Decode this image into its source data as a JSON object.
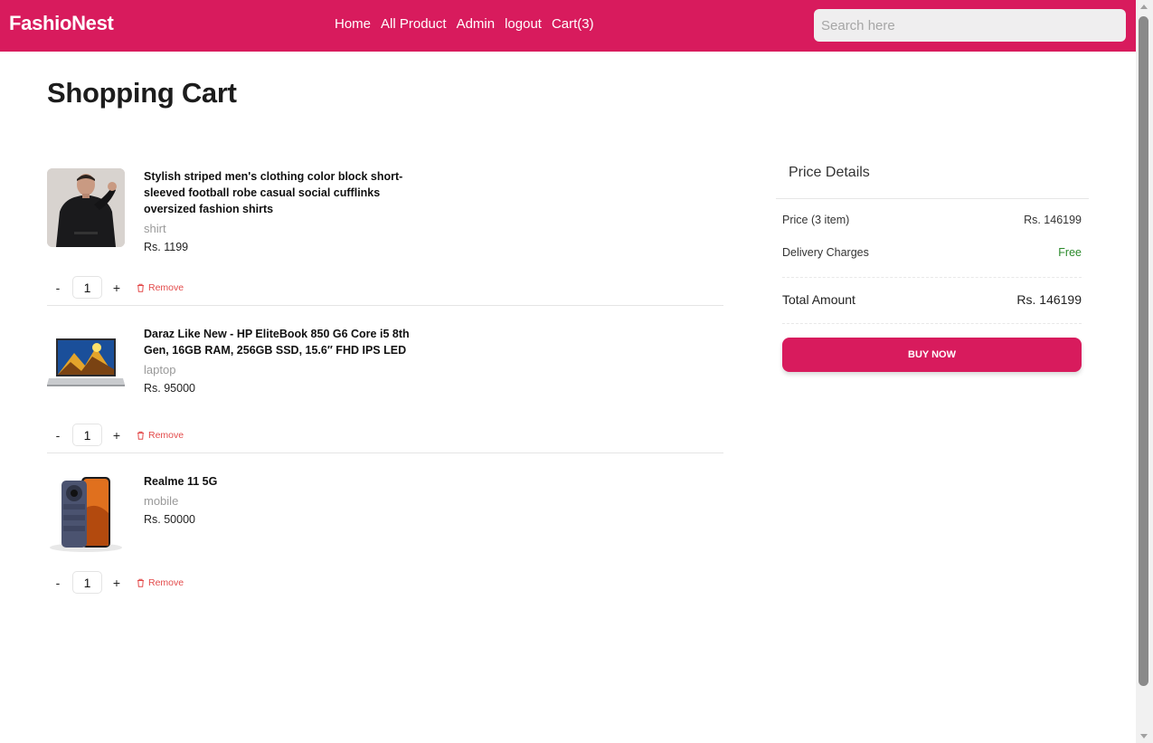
{
  "header": {
    "brand": "FashioNest",
    "nav": [
      "Home",
      "All Product",
      "Admin",
      "logout",
      "Cart(3)"
    ],
    "search_placeholder": "Search here",
    "brand_color": "#d81b5d"
  },
  "page_title": "Shopping Cart",
  "cart": {
    "items": [
      {
        "name": "Stylish striped men's clothing color block short-sleeved football robe casual social cufflinks oversized fashion shirts",
        "category": "shirt",
        "price": "Rs. 1199",
        "quantity": "1",
        "image_icon": "black-shirt-photo"
      },
      {
        "name": "Daraz Like New - HP EliteBook 850 G6 Core i5 8th Gen, 16GB RAM, 256GB SSD, 15.6″ FHD IPS LED",
        "category": "laptop",
        "price": "Rs. 95000",
        "quantity": "1",
        "image_icon": "laptop-photo"
      },
      {
        "name": "Realme 11 5G",
        "category": "mobile",
        "price": "Rs. 50000",
        "quantity": "1",
        "image_icon": "phone-photo"
      }
    ],
    "minus_label": "-",
    "plus_label": "+",
    "remove_label": "Remove"
  },
  "price_details": {
    "title": "Price Details",
    "price_label": "Price (3 item)",
    "price_value": "Rs. 146199",
    "delivery_label": "Delivery Charges",
    "delivery_value": "Free",
    "total_label": "Total Amount",
    "total_value": "Rs. 146199",
    "buy_label": "BUY NOW"
  }
}
